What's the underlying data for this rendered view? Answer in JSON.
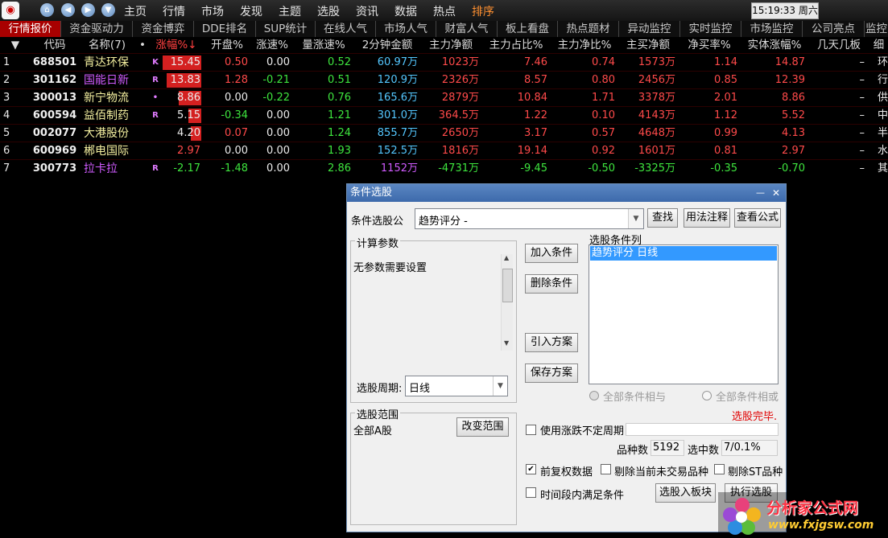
{
  "topbar": {
    "logo": "◉",
    "nav": [
      "⌂",
      "◀",
      "▶",
      "▼"
    ],
    "menus": [
      "主页",
      "行情",
      "市场",
      "发现",
      "主题",
      "选股",
      "资讯",
      "数据",
      "热点",
      "排序"
    ],
    "active_menu": "排序",
    "clock": "15:19:33 周六"
  },
  "tabs": [
    "行情报价",
    "资金驱动力",
    "资金博弈",
    "DDE排名",
    "SUP统计",
    "在线人气",
    "市场人气",
    "财富人气",
    "板上看盘",
    "热点题材",
    "异动监控",
    "实时监控",
    "市场监控",
    "公司亮点",
    "监控"
  ],
  "table": {
    "headers": [
      "",
      "代码",
      "名称(7)",
      "•",
      "涨幅%↓",
      "开盘%",
      "涨速%",
      "量涨速%",
      "2分钟金额",
      "主力净额",
      "主力占比%",
      "主力净比%",
      "主买净额",
      "净买率%",
      "实体涨幅%",
      "几天几板",
      "细"
    ],
    "rows": [
      {
        "idx": "1",
        "code": "688501",
        "name": "青达环保",
        "mark": "K",
        "chg": "15.45",
        "open": "0.50",
        "speed": "0.00",
        "vol_speed": "0.52",
        "amt2m": "60.97万",
        "main_net": "1023万",
        "main_ratio": "7.46",
        "main_net_ratio": "0.74",
        "buy_net": "1573万",
        "net_buy_rate": "1.14",
        "body_chg": "14.87",
        "boards": "–",
        "detail": "环"
      },
      {
        "idx": "2",
        "code": "301162",
        "name": "国能日新",
        "mark": "R",
        "chg": "13.83",
        "open": "1.28",
        "speed": "-0.21",
        "vol_speed": "0.51",
        "amt2m": "120.9万",
        "main_net": "2326万",
        "main_ratio": "8.57",
        "main_net_ratio": "0.80",
        "buy_net": "2456万",
        "net_buy_rate": "0.85",
        "body_chg": "12.39",
        "boards": "–",
        "detail": "行"
      },
      {
        "idx": "3",
        "code": "300013",
        "name": "新宁物流",
        "mark": "•",
        "chg": "8.86",
        "open": "0.00",
        "speed": "-0.22",
        "vol_speed": "0.76",
        "amt2m": "165.6万",
        "main_net": "2879万",
        "main_ratio": "10.84",
        "main_net_ratio": "1.71",
        "buy_net": "3378万",
        "net_buy_rate": "2.01",
        "body_chg": "8.86",
        "boards": "–",
        "detail": "供"
      },
      {
        "idx": "4",
        "code": "600594",
        "name": "益佰制药",
        "mark": "R",
        "chg": "5.15",
        "open": "-0.34",
        "speed": "0.00",
        "vol_speed": "1.21",
        "amt2m": "301.0万",
        "main_net": "364.5万",
        "main_ratio": "1.22",
        "main_net_ratio": "0.10",
        "buy_net": "4143万",
        "net_buy_rate": "1.12",
        "body_chg": "5.52",
        "boards": "–",
        "detail": "中"
      },
      {
        "idx": "5",
        "code": "002077",
        "name": "大港股份",
        "mark": "",
        "chg": "4.20",
        "open": "0.07",
        "speed": "0.00",
        "vol_speed": "1.24",
        "amt2m": "855.7万",
        "main_net": "2650万",
        "main_ratio": "3.17",
        "main_net_ratio": "0.57",
        "buy_net": "4648万",
        "net_buy_rate": "0.99",
        "body_chg": "4.13",
        "boards": "–",
        "detail": "半"
      },
      {
        "idx": "6",
        "code": "600969",
        "name": "郴电国际",
        "mark": "",
        "chg": "2.97",
        "open": "0.00",
        "speed": "0.00",
        "vol_speed": "1.93",
        "amt2m": "152.5万",
        "main_net": "1816万",
        "main_ratio": "19.14",
        "main_net_ratio": "0.92",
        "buy_net": "1601万",
        "net_buy_rate": "0.81",
        "body_chg": "2.97",
        "boards": "–",
        "detail": "水"
      },
      {
        "idx": "7",
        "code": "300773",
        "name": "拉卡拉",
        "mark": "R",
        "chg": "-2.17",
        "open": "-1.48",
        "speed": "0.00",
        "vol_speed": "2.86",
        "amt2m": "1152万",
        "main_net": "-4731万",
        "main_ratio": "-9.45",
        "main_net_ratio": "-0.50",
        "buy_net": "-3325万",
        "net_buy_rate": "-0.35",
        "body_chg": "-0.70",
        "boards": "–",
        "detail": "其"
      }
    ]
  },
  "dialog": {
    "title": "条件选股",
    "formula_label": "条件选股公",
    "formula_value": "趋势评分  -",
    "find_btn": "查找",
    "usage_btn": "用法注释",
    "view_formula_btn": "查看公式",
    "params_group": "计算参数",
    "params_text": "无参数需要设置",
    "period_label": "选股周期:",
    "period_value": "日线",
    "range_group": "选股范围",
    "range_value": "全部A股",
    "change_range_btn": "改变范围",
    "add_cond_btn": "加入条件",
    "del_cond_btn": "删除条件",
    "import_btn": "引入方案",
    "save_btn": "保存方案",
    "cond_list_label": "选股条件列",
    "cond_items": [
      "趋势评分  日线"
    ],
    "and_label": "全部条件相与",
    "or_label": "全部条件相或",
    "status": "选股完毕.",
    "use_period_label": "使用涨跌不定周期",
    "count_label": "品种数",
    "count_value": "5192",
    "selected_label": "选中数",
    "selected_value": "7/0.1%",
    "pre_adjust_label": "前复权数据",
    "exclude_untraded_label": "剔除当前未交易品种",
    "exclude_st_label": "剔除ST品种",
    "time_range_label": "时间段内满足条件",
    "to_block_btn": "选股入板块",
    "execute_btn": "执行选股",
    "minimize": "—",
    "close": "✕"
  },
  "watermark": {
    "title": "分析家公式网",
    "url": "www.fxjgsw.com"
  },
  "colors": {
    "up": "#ff4a4a",
    "down": "#3ee53e",
    "accent_tab": "#a80000",
    "bar": "#d42020"
  }
}
